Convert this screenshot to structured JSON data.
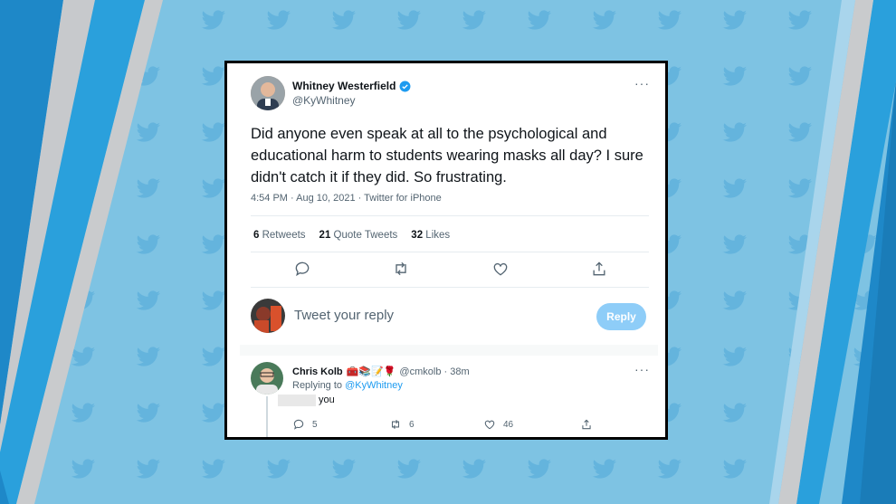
{
  "tweet": {
    "author_name": "Whitney Westerfield",
    "handle": "@KyWhitney",
    "verified_icon": "verified-badge-icon",
    "text": "Did anyone even speak at all to the psychological and educational harm to students wearing masks all day? I sure didn't catch it if they did. So frustrating.",
    "timestamp": "4:54 PM · Aug 10, 2021 · Twitter for iPhone",
    "stats": {
      "retweets_count": "6",
      "retweets_label": "Retweets",
      "quote_count": "21",
      "quote_label": "Quote Tweets",
      "likes_count": "32",
      "likes_label": "Likes"
    },
    "more_label": "···"
  },
  "reply_box": {
    "placeholder": "Tweet your reply",
    "button_label": "Reply"
  },
  "reply_tweet": {
    "author_name": "Chris Kolb",
    "emojis": "🧰📚📝🌹",
    "handle_time": "@cmkolb · 38m",
    "replying_prefix": "Replying to",
    "replying_handle": "@KyWhitney",
    "text": "you",
    "reply_count": "5",
    "retweet_count": "6",
    "like_count": "46",
    "more_label": "···"
  },
  "colors": {
    "background": "#7ec3e3",
    "accent": "#1d9bf0",
    "reply_button": "#8ecdf8"
  }
}
